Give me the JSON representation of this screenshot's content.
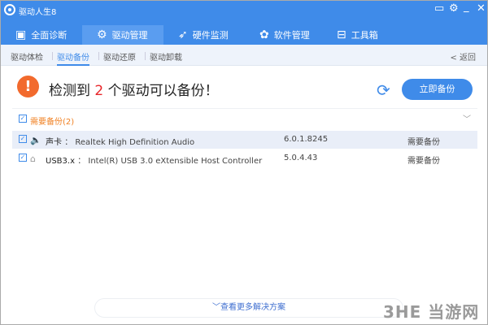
{
  "app": {
    "title": "驱动人生8"
  },
  "window_controls": {
    "feedback": "▭",
    "settings": "⚙",
    "minimize": "_",
    "close": "✕"
  },
  "tabs": [
    {
      "label": "全面诊断",
      "icon": "monitor-icon",
      "glyph": "▣"
    },
    {
      "label": "驱动管理",
      "icon": "gear-icon",
      "glyph": "⚙",
      "active": true
    },
    {
      "label": "硬件监测",
      "icon": "rocket-icon",
      "glyph": "➶"
    },
    {
      "label": "软件管理",
      "icon": "flower-icon",
      "glyph": "✿"
    },
    {
      "label": "工具箱",
      "icon": "toolbox-icon",
      "glyph": "⊟"
    }
  ],
  "subnav": {
    "items": [
      "驱动体检",
      "驱动备份",
      "驱动还原",
      "驱动卸载"
    ],
    "active_index": 1,
    "back": "< 返回"
  },
  "alert": {
    "icon": "!",
    "prefix": "检测到 ",
    "count": "2",
    "suffix": " 个驱动可以备份！"
  },
  "refresh_glyph": "⟳",
  "backup_button": "立即备份",
  "section": {
    "label": "需要备份(2)",
    "checked": true,
    "chevron": "﹀"
  },
  "drivers": [
    {
      "type": "声卡",
      "sep": "：",
      "name": "Realtek High Definition Audio",
      "version": "6.0.1.8245",
      "status": "需要备份",
      "icon": "speaker-icon",
      "glyph": "🔈",
      "checked": true
    },
    {
      "type": "USB3.x",
      "sep": "：",
      "name": "Intel(R) USB 3.0 eXtensible Host Controller",
      "version": "5.0.4.43",
      "status": "需要备份",
      "icon": "usb-drive-icon",
      "glyph": "⌂",
      "checked": true
    }
  ],
  "more_solutions": "﹀查看更多解决方案",
  "watermark": "3HE 当游网",
  "colors": {
    "brand": "#3f8be9",
    "alert": "#f26a2d",
    "count": "#e8262a",
    "section": "#f08022"
  }
}
